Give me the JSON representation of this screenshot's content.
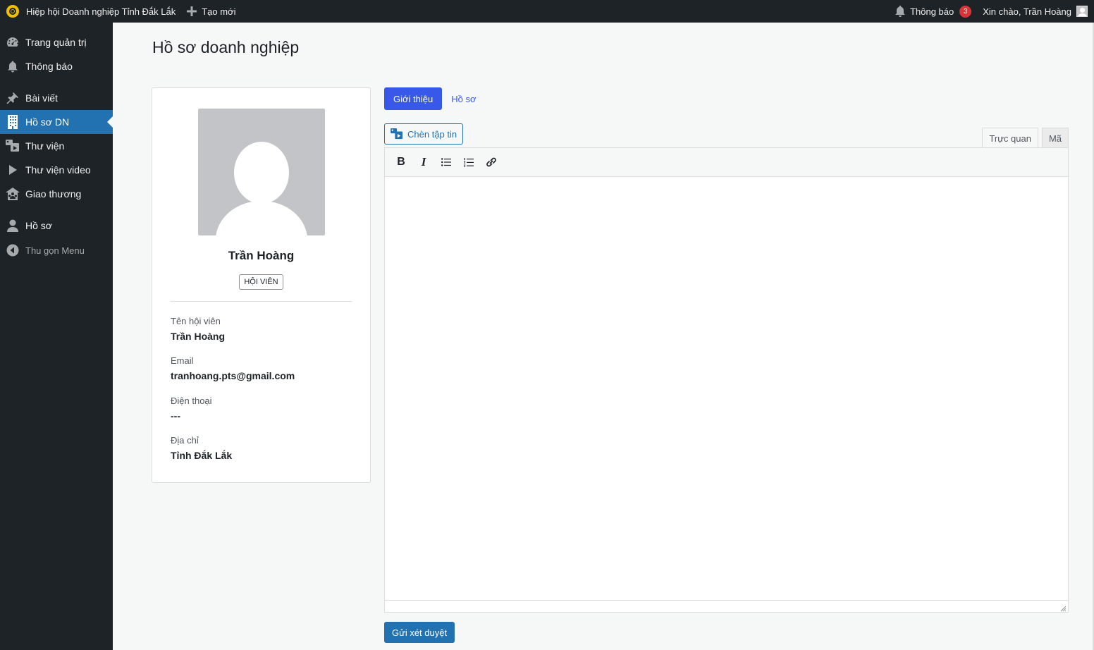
{
  "adminbar": {
    "site_name": "Hiệp hội Doanh nghiệp Tỉnh Đắk Lắk",
    "new_label": "Tạo mới",
    "notifications_label": "Thông báo",
    "notifications_count": "3",
    "greeting": "Xin chào, Trần Hoàng"
  },
  "sidebar": {
    "items": [
      {
        "label": "Trang quản trị",
        "icon": "dashboard-icon"
      },
      {
        "label": "Thông báo",
        "icon": "bell-icon"
      },
      {
        "label": "Bài viết",
        "icon": "pin-icon"
      },
      {
        "label": "Hồ sơ DN",
        "icon": "building-icon",
        "active": true
      },
      {
        "label": "Thư viện",
        "icon": "media-icon"
      },
      {
        "label": "Thư viện video",
        "icon": "play-icon"
      },
      {
        "label": "Giao thương",
        "icon": "groups-icon"
      },
      {
        "label": "Hồ sơ",
        "icon": "user-icon"
      }
    ],
    "collapse_label": "Thu gọn Menu"
  },
  "page": {
    "title": "Hồ sơ doanh nghiệp"
  },
  "profile": {
    "name": "Trần Hoàng",
    "role": "HỘI VIÊN",
    "fields": [
      {
        "label": "Tên hội viên",
        "value": "Trần Hoàng"
      },
      {
        "label": "Email",
        "value": "tranhoang.pts@gmail.com"
      },
      {
        "label": "Điện thoại",
        "value": "---"
      },
      {
        "label": "Địa chỉ",
        "value": "Tỉnh Đắk Lắk"
      }
    ]
  },
  "tabs": {
    "intro": "Giới thiệu",
    "profile": "Hồ sơ"
  },
  "editor": {
    "insert_media": "Chèn tập tin",
    "visual_tab": "Trực quan",
    "code_tab": "Mã",
    "content": ""
  },
  "submit": {
    "label": "Gửi xét duyệt"
  },
  "colors": {
    "adminbar_bg": "#1d2327",
    "active_menu": "#2271b1",
    "tab_active": "#3858e9",
    "badge": "#d63638"
  }
}
